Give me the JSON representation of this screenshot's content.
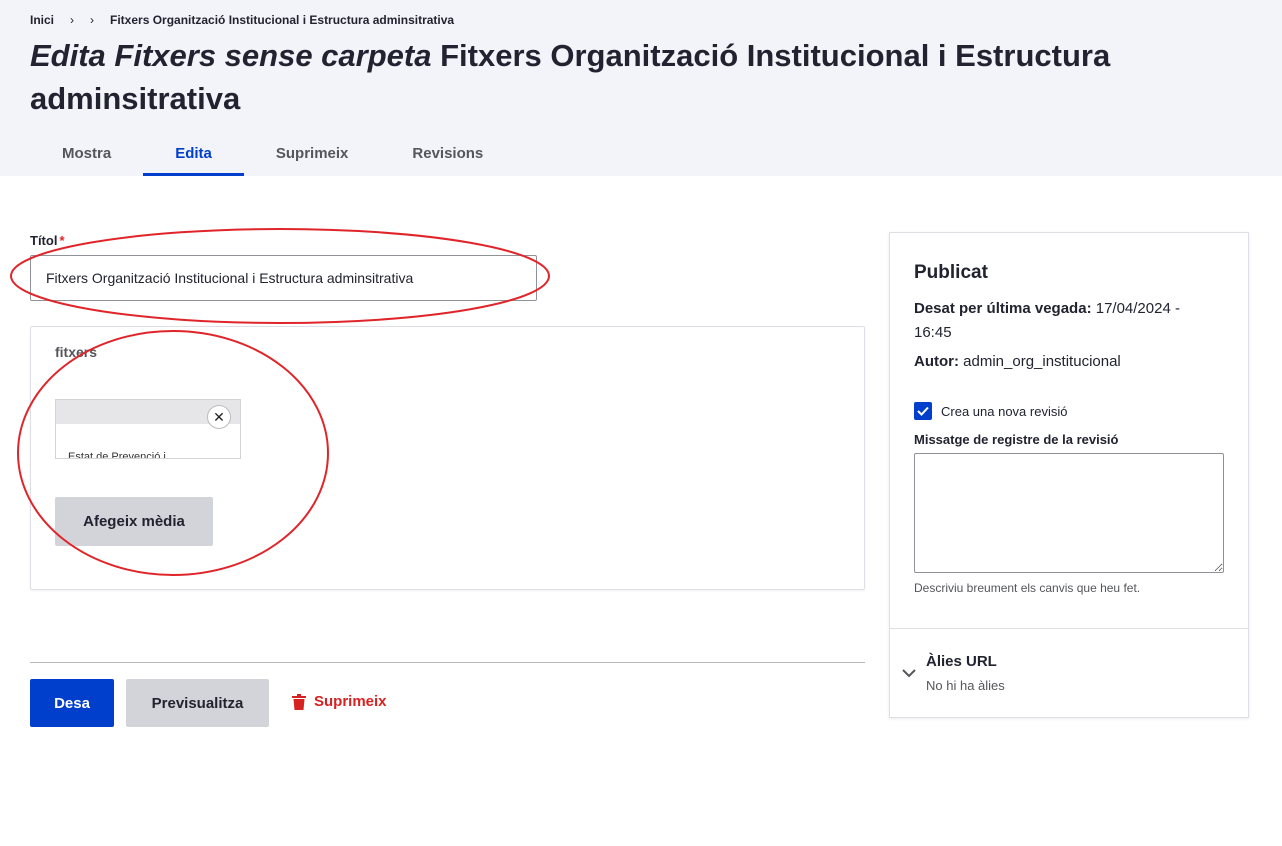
{
  "breadcrumb": {
    "home": "Inici",
    "sep1": "›",
    "sep2": "›",
    "current": "Fitxers Organització Institucional i Estructura adminsitrativa"
  },
  "page": {
    "title_italic": "Edita Fitxers sense carpeta",
    "title_rest": " Fitxers Organització Institucional i Estructura adminsitrativa"
  },
  "tabs": [
    {
      "label": "Mostra"
    },
    {
      "label": "Edita"
    },
    {
      "label": "Suprimeix"
    },
    {
      "label": "Revisions"
    }
  ],
  "form": {
    "title_label": "Títol",
    "required_mark": "*",
    "title_value": "Fitxers Organització Institucional i Estructura adminsitrativa",
    "media_field_label": "fitxers",
    "media_item_text": "Estat de Prevenció i",
    "remove_glyph": "✕",
    "add_media_label": "Afegeix mèdia"
  },
  "actions": {
    "save": "Desa",
    "preview": "Previsualitza",
    "delete": "Suprimeix"
  },
  "sidebar": {
    "status": "Publicat",
    "last_saved_label": "Desat per última vegada:",
    "last_saved_value": " 17/04/2024 - 16:45",
    "author_label": "Autor:",
    "author_value": " admin_org_institucional",
    "new_revision_label": "Crea una nova revisió",
    "new_revision_checked": true,
    "revision_log_label": "Missatge de registre de la revisió",
    "revision_log_desc": "Descriviu breument els canvis que heu fet.",
    "alias_title": "Àlies URL",
    "alias_sub": "No hi ha àlies"
  },
  "colors": {
    "accent": "#003ecc",
    "danger": "#d72222",
    "annotation": "#e0252a"
  }
}
